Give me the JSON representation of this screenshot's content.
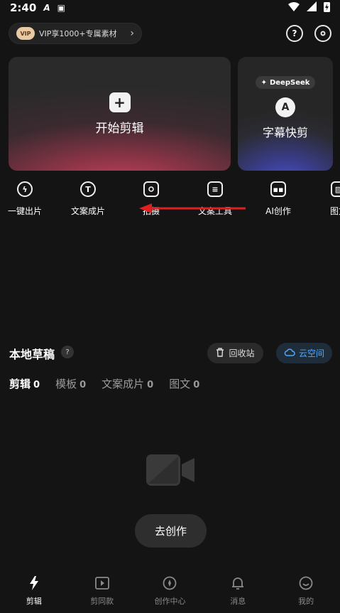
{
  "status_bar": {
    "time": "2:40",
    "icons": [
      "a-stylized-icon",
      "a-square-icon",
      "wifi-icon",
      "signal-icon",
      "battery-charging-icon"
    ]
  },
  "vip": {
    "badge": "VIP",
    "label": "VIP享1000+专属素材"
  },
  "header_icons": [
    "help-icon",
    "settings-icon"
  ],
  "cards": {
    "start_edit": {
      "label": "开始剪辑"
    },
    "subtitle_cut": {
      "badge": "DeepSeek",
      "label": "字幕快剪"
    }
  },
  "tools": [
    {
      "label": "一键出片",
      "icon": "lightning-circle-icon"
    },
    {
      "label": "文案成片",
      "icon": "text-ai-icon"
    },
    {
      "label": "拍摄",
      "icon": "camera-icon"
    },
    {
      "label": "文案工具",
      "icon": "document-sparkle-icon"
    },
    {
      "label": "AI创作",
      "icon": "robot-icon"
    },
    {
      "label": "图文",
      "icon": "image-text-icon"
    }
  ],
  "drafts": {
    "title": "本地草稿",
    "help": "?",
    "recycle": "回收站",
    "cloud": "云空间",
    "tabs": [
      {
        "label": "剪辑",
        "count": "0"
      },
      {
        "label": "模板",
        "count": "0"
      },
      {
        "label": "文案成片",
        "count": "0"
      },
      {
        "label": "图文",
        "count": "0"
      }
    ],
    "create_button": "去创作"
  },
  "bottom_nav": [
    {
      "label": "剪辑",
      "icon": "cut-lightning-icon"
    },
    {
      "label": "剪同款",
      "icon": "play-frame-icon"
    },
    {
      "label": "创作中心",
      "icon": "compass-icon"
    },
    {
      "label": "消息",
      "icon": "bell-icon"
    },
    {
      "label": "我的",
      "icon": "smile-icon"
    }
  ],
  "colors": {
    "background": "#141414",
    "accent_blue": "#4fa8ff",
    "arrow_red": "#e02020",
    "card_red": "#c9435e",
    "card_blue": "#4b55d8"
  }
}
